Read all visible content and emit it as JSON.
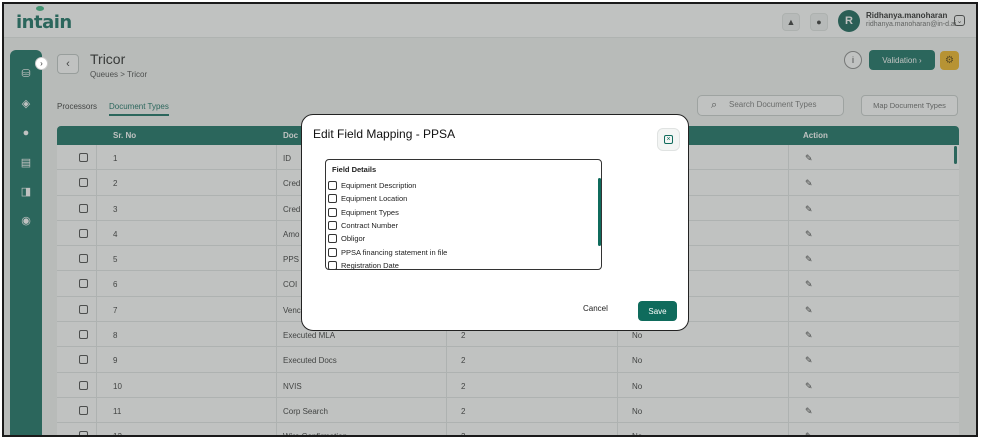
{
  "app": {
    "logo_text": "intain"
  },
  "topbar": {
    "bell_icon": "bell-icon",
    "help_icon": "info-icon",
    "avatar_initial": "R",
    "user_name": "Ridhanya.manoharan",
    "user_email": "ridhanya.manoharan@in-d.ai"
  },
  "sidebar": {
    "icons": [
      "robot-icon",
      "layers-icon",
      "user-icon",
      "document-icon",
      "split-icon",
      "globe-icon"
    ]
  },
  "header": {
    "title": "Tricor",
    "breadcrumb": "Queues > Tricor",
    "validation_label": "Validation  ›",
    "back_glyph": "‹",
    "info_glyph": "i",
    "settings_glyph": "⚙"
  },
  "tabs": [
    {
      "label": "Processors"
    },
    {
      "label": "Document Types"
    }
  ],
  "search": {
    "placeholder": "Search Document Types"
  },
  "map_button_label": "Map Document Types",
  "table": {
    "columns": [
      "Sr. No",
      "Doc",
      "",
      "",
      "Action"
    ],
    "rows": [
      {
        "sr": "1",
        "doc": "ID",
        "c3": "",
        "c4": ""
      },
      {
        "sr": "2",
        "doc": "Cred",
        "c3": "",
        "c4": ""
      },
      {
        "sr": "3",
        "doc": "Cred",
        "c3": "",
        "c4": ""
      },
      {
        "sr": "4",
        "doc": "Amo",
        "c3": "",
        "c4": ""
      },
      {
        "sr": "5",
        "doc": "PPS",
        "c3": "",
        "c4": ""
      },
      {
        "sr": "6",
        "doc": "COI",
        "c3": "",
        "c4": ""
      },
      {
        "sr": "7",
        "doc": "Venc",
        "c3": "",
        "c4": ""
      },
      {
        "sr": "8",
        "doc": "Executed MLA",
        "c3": "2",
        "c4": "No"
      },
      {
        "sr": "9",
        "doc": "Executed Docs",
        "c3": "2",
        "c4": "No"
      },
      {
        "sr": "10",
        "doc": "NVIS",
        "c3": "2",
        "c4": "No"
      },
      {
        "sr": "11",
        "doc": "Corp Search",
        "c3": "2",
        "c4": "No"
      },
      {
        "sr": "12",
        "doc": "Wire Confirmation",
        "c3": "2",
        "c4": "No"
      }
    ]
  },
  "modal": {
    "title": "Edit Field Mapping - PPSA",
    "section_label": "Field Details",
    "fields": [
      "Equipment Description",
      "Equipment Location",
      "Equipment Types",
      "Contract Number",
      "Obligor",
      "PPSA financing statement in file",
      "Registration Date"
    ],
    "cancel_label": "Cancel",
    "save_label": "Save"
  },
  "colors": {
    "primary": "#0f6b5c",
    "accent": "#f0b41c"
  }
}
